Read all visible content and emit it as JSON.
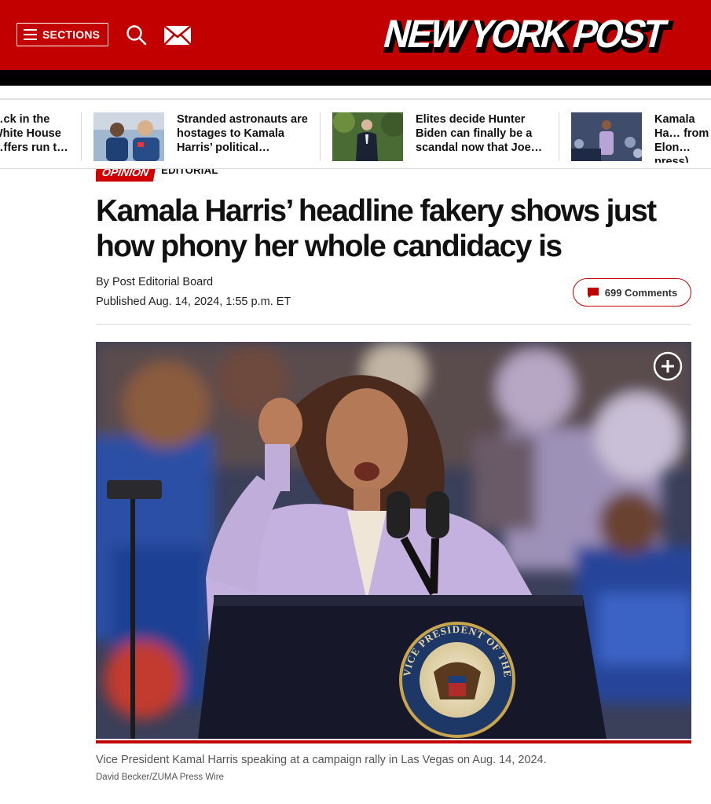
{
  "header": {
    "sections_label": "SECTIONS",
    "logo_text": "NEW YORK POST",
    "brand_color": "#c20000"
  },
  "icons": [
    "hamburger-icon",
    "search-icon",
    "mail-icon",
    "comment-icon",
    "plus-circle-icon"
  ],
  "story_strip": [
    {
      "headline": "…ck in the White House …ffers run t…"
    },
    {
      "headline": "Stranded astronauts are hostages to Kamala Harris’ political…"
    },
    {
      "headline": "Elites decide Hunter Biden can finally be a scandal now that Joe…"
    },
    {
      "headline": "Kamala Ha… from Elon… press) bec…"
    }
  ],
  "article": {
    "section": "OPINION",
    "subsection": "EDITORIAL",
    "title": "Kamala Harris’ headline fakery shows just how phony her whole candidacy is",
    "byline": "By Post Editorial Board",
    "published": "Published Aug. 14, 2024, 1:55 p.m. ET",
    "comments_label": "699 Comments",
    "photo_caption": "Vice President Kamal Harris speaking at a campaign rally in Las Vegas on Aug. 14, 2024.",
    "photo_credit": "David Becker/ZUMA Press Wire",
    "podium_seal_text": "VICE PRESIDENT OF THE UNITED STATES"
  }
}
